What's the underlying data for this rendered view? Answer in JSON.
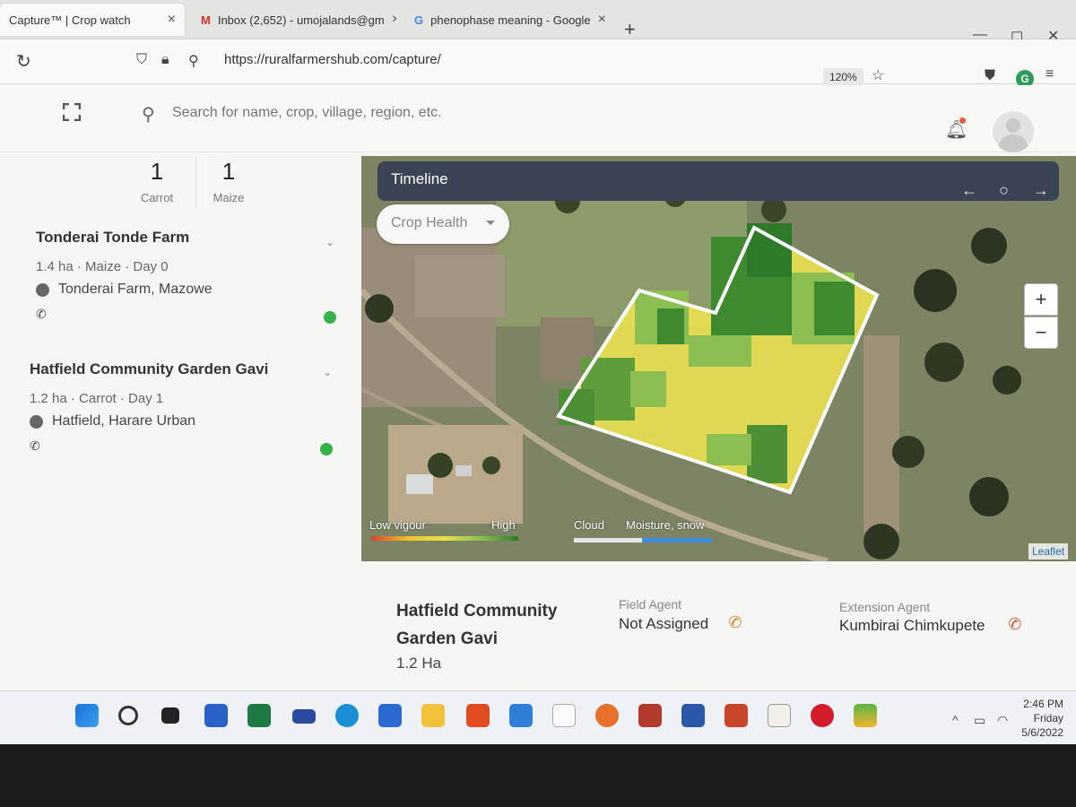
{
  "browser": {
    "tabs": [
      {
        "title": "Capture™ | Crop watch",
        "icon": "capture-favicon"
      },
      {
        "title": "Inbox (2,652) - umojalands@gm",
        "icon": "gmail-icon"
      },
      {
        "title": "phenophase meaning - Google",
        "icon": "google-icon"
      }
    ],
    "url": "https://ruralfarmershub.com/capture/",
    "zoom": "120%"
  },
  "header": {
    "search_placeholder": "Search for name, crop, village, region, etc.",
    "notification_dot_color": "#e85a3c"
  },
  "summary": {
    "counts": [
      {
        "value": "1",
        "label": "Carrot"
      },
      {
        "value": "1",
        "label": "Maize"
      }
    ]
  },
  "farms": [
    {
      "name": "Tonderai Tonde Farm",
      "meta": "1.4 ha · Maize · Day 0",
      "location": "Tonderai Farm, Mazowe",
      "status_color": "#34b34a"
    },
    {
      "name": "Hatfield Community Garden Gavi",
      "meta": "1.2 ha · Carrot · Day 1",
      "location": "Hatfield, Harare Urban",
      "status_color": "#34b34a"
    }
  ],
  "map": {
    "timeline_title": "Timeline",
    "layer_select": "Crop Health",
    "zoom_in": "+",
    "zoom_out": "−",
    "legend": {
      "low": "Low vigour",
      "high": "High",
      "cloud": "Cloud",
      "moisture": "Moisture, snow"
    },
    "attribution": "Leaflet"
  },
  "detail": {
    "name": "Hatfield Community Garden Gavi",
    "area": "1.2 Ha",
    "field_agent_label": "Field Agent",
    "field_agent_value": "Not Assigned",
    "extension_agent_label": "Extension Agent",
    "extension_agent_value": "Kumbirai Chimkupete"
  },
  "taskbar": {
    "time": "2:46 PM",
    "day": "Friday",
    "date": "5/6/2022"
  }
}
